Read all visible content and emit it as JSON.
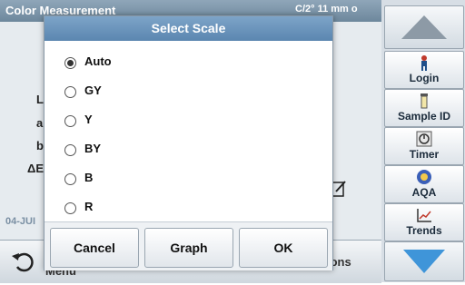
{
  "background": {
    "title": "Color Measurement",
    "title_right": "C/2°     11 mm o",
    "labels": [
      "L",
      "a",
      "b",
      "ΔE"
    ],
    "date": "04-JUI",
    "bottom_text": "Menu",
    "options_text": "ions"
  },
  "dialog": {
    "title": "Select Scale",
    "options": [
      {
        "label": "Auto",
        "selected": true
      },
      {
        "label": "GY",
        "selected": false
      },
      {
        "label": "Y",
        "selected": false
      },
      {
        "label": "BY",
        "selected": false
      },
      {
        "label": "B",
        "selected": false
      },
      {
        "label": "R",
        "selected": false
      }
    ],
    "buttons": {
      "cancel": "Cancel",
      "graph": "Graph",
      "ok": "OK"
    }
  },
  "toolbar": {
    "up_icon": "triangle-up-icon",
    "down_icon": "triangle-down-icon",
    "items": [
      {
        "label": "Login",
        "icon": "person-icon"
      },
      {
        "label": "Sample ID",
        "icon": "vial-icon"
      },
      {
        "label": "Timer",
        "icon": "timer-icon"
      },
      {
        "label": "AQA",
        "icon": "aqa-icon"
      },
      {
        "label": "Trends",
        "icon": "trend-chart-icon"
      }
    ]
  },
  "colors": {
    "header_blue": "#6b93bb",
    "toolbar_arrow": "#4f7fb0",
    "down_arrow": "#3f95d9"
  }
}
